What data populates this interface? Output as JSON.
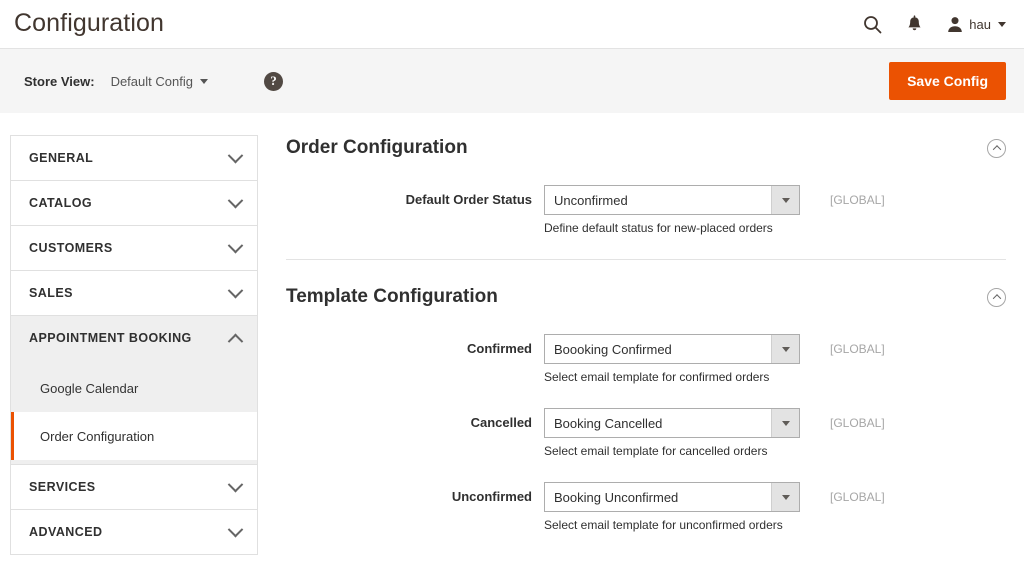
{
  "header": {
    "title": "Configuration",
    "search_icon": "search-icon",
    "notifications_icon": "bell-icon",
    "user_icon": "user-avatar-icon",
    "user_name": "hau"
  },
  "storeview": {
    "label": "Store View:",
    "value": "Default Config",
    "help_icon": "question-mark-icon",
    "help_glyph": "?",
    "save_label": "Save Config"
  },
  "colors": {
    "accent": "#eb5202",
    "header_text": "#41362f",
    "panel_gray": "#efefef"
  },
  "sidebar": {
    "sections": [
      {
        "label": "GENERAL",
        "expanded": false,
        "icon": "chevron-down-icon"
      },
      {
        "label": "CATALOG",
        "expanded": false,
        "icon": "chevron-down-icon"
      },
      {
        "label": "CUSTOMERS",
        "expanded": false,
        "icon": "chevron-down-icon"
      },
      {
        "label": "SALES",
        "expanded": false,
        "icon": "chevron-down-icon"
      },
      {
        "label": "APPOINTMENT BOOKING",
        "expanded": true,
        "icon": "chevron-up-icon"
      },
      {
        "label": "SERVICES",
        "expanded": false,
        "icon": "chevron-down-icon"
      },
      {
        "label": "ADVANCED",
        "expanded": false,
        "icon": "chevron-down-icon"
      }
    ],
    "subitems": [
      {
        "label": "Google Calendar",
        "active": false
      },
      {
        "label": "Order Configuration",
        "active": true
      }
    ]
  },
  "content": {
    "sections": [
      {
        "title": "Order Configuration",
        "collapse_icon": "chevron-up-circle-icon",
        "fields": [
          {
            "label": "Default Order Status",
            "value": "Unconfirmed",
            "note": "Define default status for new-placed orders",
            "scope": "[GLOBAL]"
          }
        ]
      },
      {
        "title": "Template Configuration",
        "collapse_icon": "chevron-up-circle-icon",
        "fields": [
          {
            "label": "Confirmed",
            "value": "Boooking Confirmed",
            "note": "Select email template for confirmed orders",
            "scope": "[GLOBAL]"
          },
          {
            "label": "Cancelled",
            "value": "Booking Cancelled",
            "note": "Select email template for cancelled orders",
            "scope": "[GLOBAL]"
          },
          {
            "label": "Unconfirmed",
            "value": "Booking Unconfirmed",
            "note": "Select email template for unconfirmed orders",
            "scope": "[GLOBAL]"
          }
        ]
      }
    ]
  }
}
